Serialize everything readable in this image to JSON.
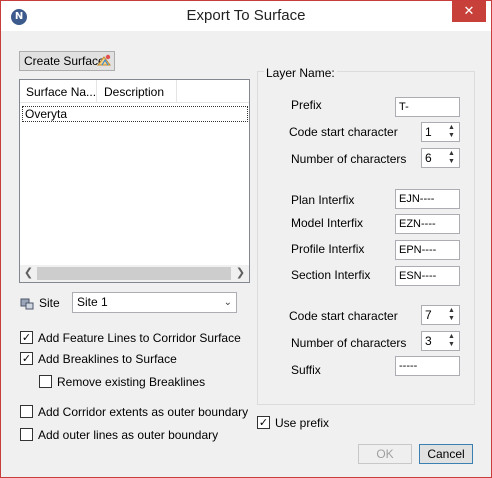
{
  "window": {
    "title": "Export To Surface",
    "app_icon": "N",
    "close_glyph": "✕"
  },
  "create_button": {
    "label": "Create Surface"
  },
  "list": {
    "columns": [
      "Surface Na...",
      "Description"
    ],
    "rows": [
      {
        "name": "Overyta",
        "description": ""
      }
    ]
  },
  "site": {
    "label": "Site",
    "value": "Site 1"
  },
  "checkboxes": [
    {
      "label": "Add Feature Lines to Corridor Surface",
      "checked": true
    },
    {
      "label": "Add Breaklines to Surface",
      "checked": true
    },
    {
      "label": "Remove existing Breaklines",
      "checked": false
    },
    {
      "label": "Add Corridor extents as outer boundary",
      "checked": false
    },
    {
      "label": "Add outer lines as outer boundary",
      "checked": false
    }
  ],
  "layer": {
    "group_label": "Layer Name:",
    "prefix_label": "Prefix",
    "prefix_value": "T-",
    "code_start_label": "Code start character",
    "code_start_value": "1",
    "num_chars_label": "Number of characters",
    "num_chars_value": "6",
    "plan_label": "Plan Interfix",
    "plan_value": "EJN----",
    "model_label": "Model Interfix",
    "model_value": "EZN----",
    "profile_label": "Profile Interfix",
    "profile_value": "EPN----",
    "section_label": "Section Interfix",
    "section_value": "ESN----",
    "code_start2_label": "Code start character",
    "code_start2_value": "7",
    "num_chars2_label": "Number of characters",
    "num_chars2_value": "3",
    "suffix_label": "Suffix",
    "suffix_value": "-----"
  },
  "use_prefix": {
    "label": "Use prefix",
    "checked": true
  },
  "buttons": {
    "ok": "OK",
    "cancel": "Cancel"
  },
  "check_glyph": "✓"
}
